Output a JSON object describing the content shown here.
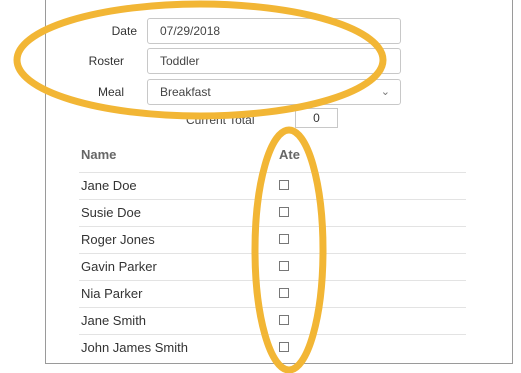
{
  "form": {
    "date_label": "Date",
    "date_value": "07/29/2018",
    "roster_label": "Roster",
    "roster_value": "Toddler",
    "meal_label": "Meal",
    "meal_value": "Breakfast",
    "meal_chevron": "chevron-down-icon",
    "current_total_label": "Current Total",
    "current_total_value": "0"
  },
  "table": {
    "columns": [
      "Name",
      "Ate"
    ],
    "rows": [
      {
        "name": "Jane Doe",
        "ate": false
      },
      {
        "name": "Susie Doe",
        "ate": false
      },
      {
        "name": "Roger Jones",
        "ate": false
      },
      {
        "name": "Gavin Parker",
        "ate": false
      },
      {
        "name": "Nia Parker",
        "ate": false
      },
      {
        "name": "Jane Smith",
        "ate": false
      },
      {
        "name": "John James Smith",
        "ate": false
      }
    ]
  },
  "annotations": {
    "highlight_color": "#f2b635"
  }
}
